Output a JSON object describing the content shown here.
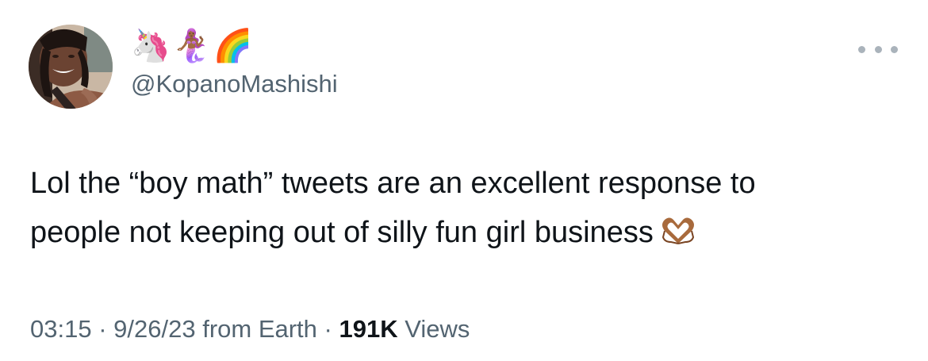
{
  "author": {
    "display_name_emojis": [
      "🦄",
      "🧜🏾‍♀️",
      "🌈"
    ],
    "handle": "@KopanoMashishi",
    "avatar_icon": "profile-photo-avatar"
  },
  "tweet": {
    "text": "Lol the “boy math” tweets are an excellent response to\npeople not keeping out of silly fun girl business",
    "trailing_emoji": "🫶🏾"
  },
  "meta": {
    "time": "03:15",
    "separator": " · ",
    "date": "9/26/23",
    "source": "from Earth",
    "views_count": "191K",
    "views_label": "Views"
  },
  "menu": {
    "icon": "more-options-icon"
  },
  "colors": {
    "text_primary": "#0f1419",
    "text_secondary": "#536471",
    "more_dots": "#aab3bb",
    "background": "#ffffff"
  }
}
